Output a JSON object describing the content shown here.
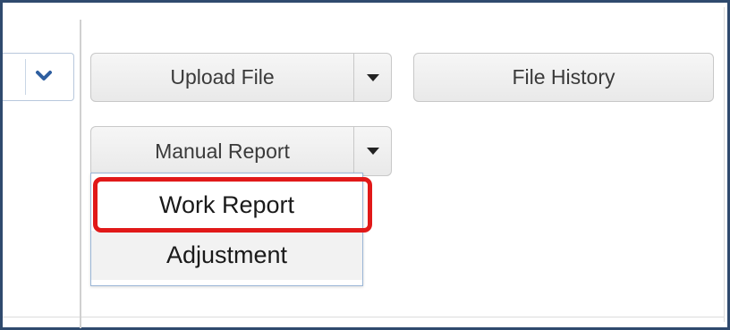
{
  "toolbar": {
    "upload_label": "Upload File",
    "history_label": "File History",
    "manual_label": "Manual Report"
  },
  "manual_menu": {
    "items": [
      {
        "label": "Work Report"
      },
      {
        "label": "Adjustment"
      }
    ],
    "highlight_color": "#e11919"
  },
  "icons": {
    "left_select": "chevron-down-icon",
    "upload_split": "caret-down-icon",
    "manual_split": "caret-down-icon"
  }
}
